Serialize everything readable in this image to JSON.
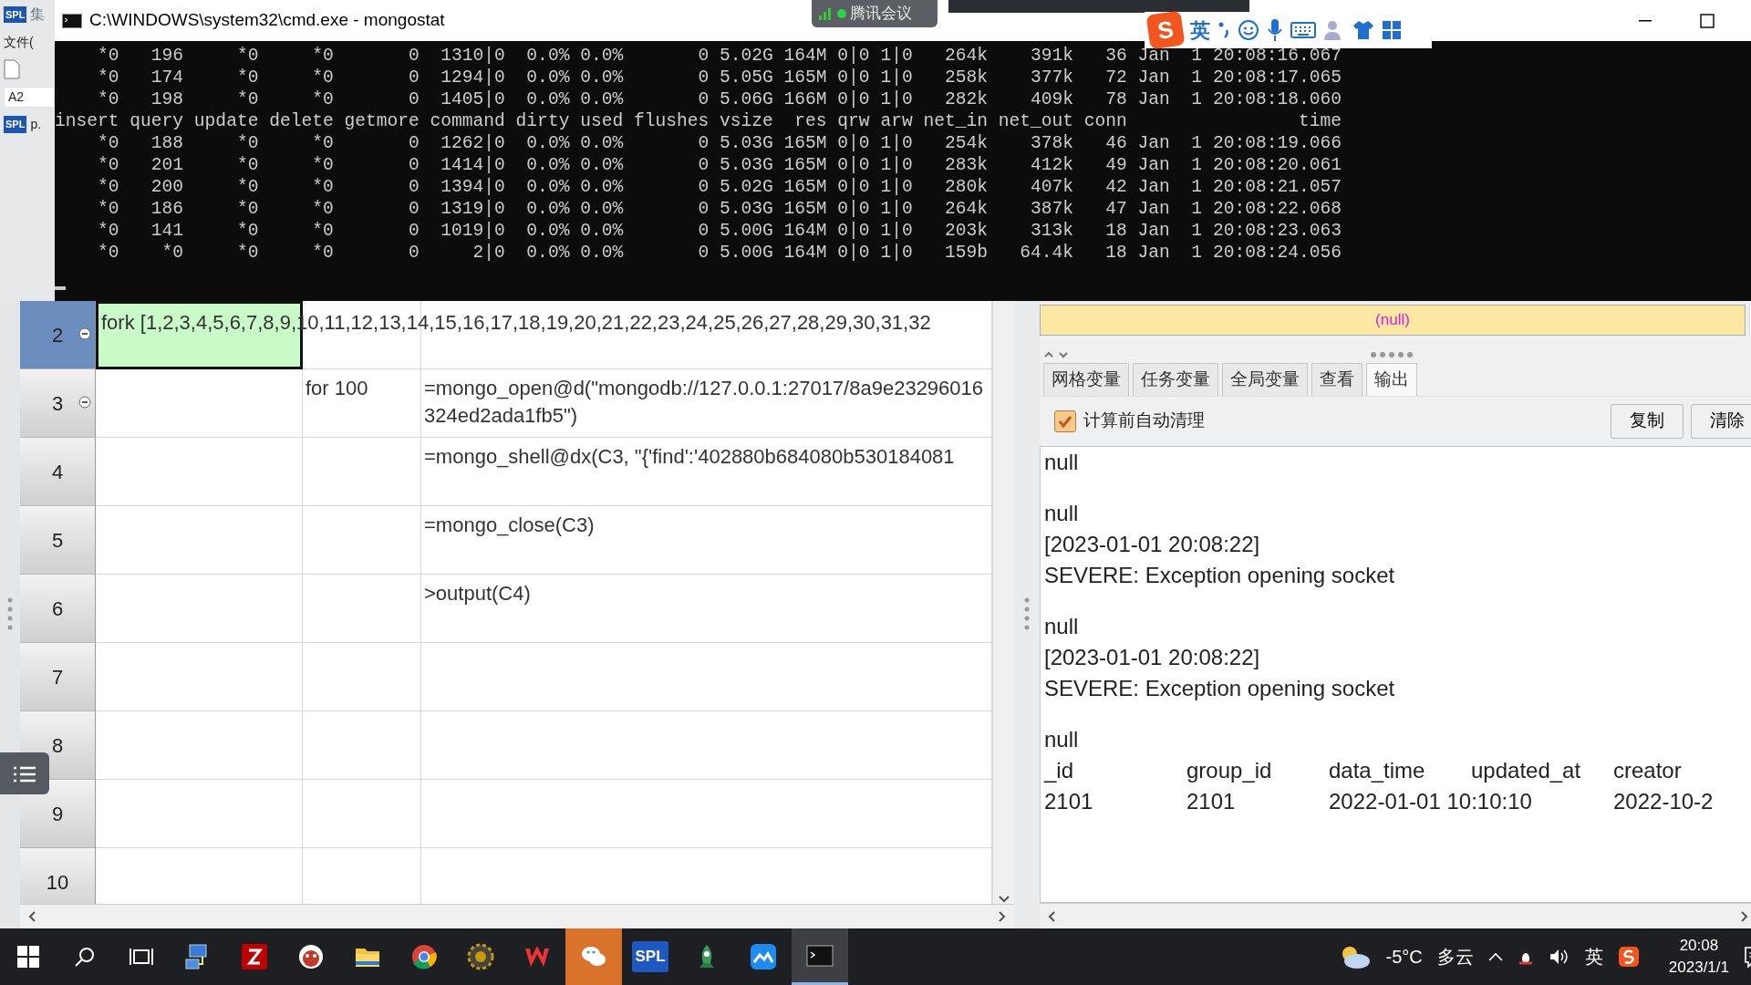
{
  "background_app": {
    "logo": "SPL",
    "title": "集",
    "menu": "文件(",
    "cell_name": "A2",
    "tab_logo": "SPL",
    "tab": "p."
  },
  "console": {
    "title": "C:\\WINDOWS\\system32\\cmd.exe - mongostat",
    "lines": [
      "    *0   196     *0     *0       0  1310|0  0.0% 0.0%       0 5.02G 164M 0|0 1|0   264k    391k   36 Jan  1 20:08:16.067",
      "    *0   174     *0     *0       0  1294|0  0.0% 0.0%       0 5.05G 165M 0|0 1|0   258k    377k   72 Jan  1 20:08:17.065",
      "    *0   198     *0     *0       0  1405|0  0.0% 0.0%       0 5.06G 166M 0|0 1|0   282k    409k   78 Jan  1 20:08:18.060",
      "insert query update delete getmore command dirty used flushes vsize  res qrw arw net_in net_out conn                time",
      "    *0   188     *0     *0       0  1262|0  0.0% 0.0%       0 5.03G 165M 0|0 1|0   254k    378k   46 Jan  1 20:08:19.066",
      "    *0   201     *0     *0       0  1414|0  0.0% 0.0%       0 5.03G 165M 0|0 1|0   283k    412k   49 Jan  1 20:08:20.061",
      "    *0   200     *0     *0       0  1394|0  0.0% 0.0%       0 5.02G 165M 0|0 1|0   280k    407k   42 Jan  1 20:08:21.057",
      "    *0   186     *0     *0       0  1319|0  0.0% 0.0%       0 5.03G 165M 0|0 1|0   264k    387k   47 Jan  1 20:08:22.068",
      "    *0   141     *0     *0       0  1019|0  0.0% 0.0%       0 5.00G 164M 0|0 1|0   203k    313k   18 Jan  1 20:08:23.063",
      "    *0    *0     *0     *0       0     2|0  0.0% 0.0%       0 5.00G 164M 0|0 1|0   159b   64.4k   18 Jan  1 20:08:24.056"
    ]
  },
  "meeting": {
    "label": "腾讯会议"
  },
  "ime": {
    "logo": "S",
    "mode": "英"
  },
  "grid": {
    "rows": [
      {
        "number": "2",
        "selected": true,
        "collapsible": true,
        "col_a": "fork [1,2,3,4,5,6,7,8,9,10,11,12,13,14,15,16,17,18,19,20,21,22,23,24,25,26,27,28,29,30,31,32"
      },
      {
        "number": "3",
        "selected": false,
        "collapsible": true,
        "col_b": "for 100",
        "col_c": "=mongo_open@d(\"mongodb://127.0.0.1:27017/8a9e23296016324ed2ada1fb5\")"
      },
      {
        "number": "4",
        "selected": false,
        "collapsible": false,
        "col_c": "=mongo_shell@dx(C3, \"{'find':'402880b684080b530184081"
      },
      {
        "number": "5",
        "selected": false,
        "collapsible": false,
        "col_c": "=mongo_close(C3)"
      },
      {
        "number": "6",
        "selected": false,
        "collapsible": false,
        "col_c": ">output(C4)"
      },
      {
        "number": "7",
        "selected": false,
        "collapsible": false
      },
      {
        "number": "8",
        "selected": false,
        "collapsible": false
      },
      {
        "number": "9",
        "selected": false,
        "collapsible": false
      },
      {
        "number": "10",
        "selected": false,
        "collapsible": false
      }
    ]
  },
  "value_field": "(null)",
  "tabs": [
    {
      "label": "网格变量",
      "selected": false
    },
    {
      "label": "任务变量",
      "selected": false
    },
    {
      "label": "全局变量",
      "selected": false
    },
    {
      "label": "查看",
      "selected": false
    },
    {
      "label": "输出",
      "selected": true
    }
  ],
  "auto_clear": {
    "label": "计算前自动清理",
    "checked": true
  },
  "buttons": [
    "复制",
    "清除"
  ],
  "output": {
    "blocks": [
      [
        "null"
      ],
      [
        "null",
        "[2023-01-01 20:08:22]",
        "SEVERE: Exception opening socket"
      ],
      [
        "null",
        "[2023-01-01 20:08:22]",
        "SEVERE: Exception opening socket"
      ],
      [
        "null"
      ]
    ],
    "table": {
      "columns": [
        "_id",
        "group_id",
        "data_time",
        "updated_at",
        "creator"
      ],
      "rows": [
        [
          "2101",
          "2101",
          "2022-01-01 10:10:10",
          null,
          "2022-10-2"
        ]
      ]
    }
  },
  "taskbar": {
    "apps": [
      {
        "kind": "network",
        "active": false,
        "flashing": false
      },
      {
        "kind": "filezilla",
        "active": false,
        "flashing": false
      },
      {
        "kind": "mascot",
        "active": false,
        "flashing": false
      },
      {
        "kind": "folder",
        "active": false,
        "flashing": false
      },
      {
        "kind": "chrome",
        "active": false,
        "flashing": false
      },
      {
        "kind": "gear",
        "active": false,
        "flashing": false
      },
      {
        "kind": "wps",
        "active": false,
        "flashing": false
      },
      {
        "kind": "wechat",
        "active": false,
        "flashing": true
      },
      {
        "kind": "spl",
        "label": "SPL",
        "active": false,
        "flashing": false
      },
      {
        "kind": "rocket",
        "active": false,
        "flashing": false
      },
      {
        "kind": "lark",
        "active": false,
        "flashing": false
      },
      {
        "kind": "terminal",
        "active": true,
        "flashing": false
      }
    ],
    "temperature": "-5°C",
    "weather": "多云",
    "ime": "英",
    "time": "20:08",
    "date": "2023/1/1"
  }
}
